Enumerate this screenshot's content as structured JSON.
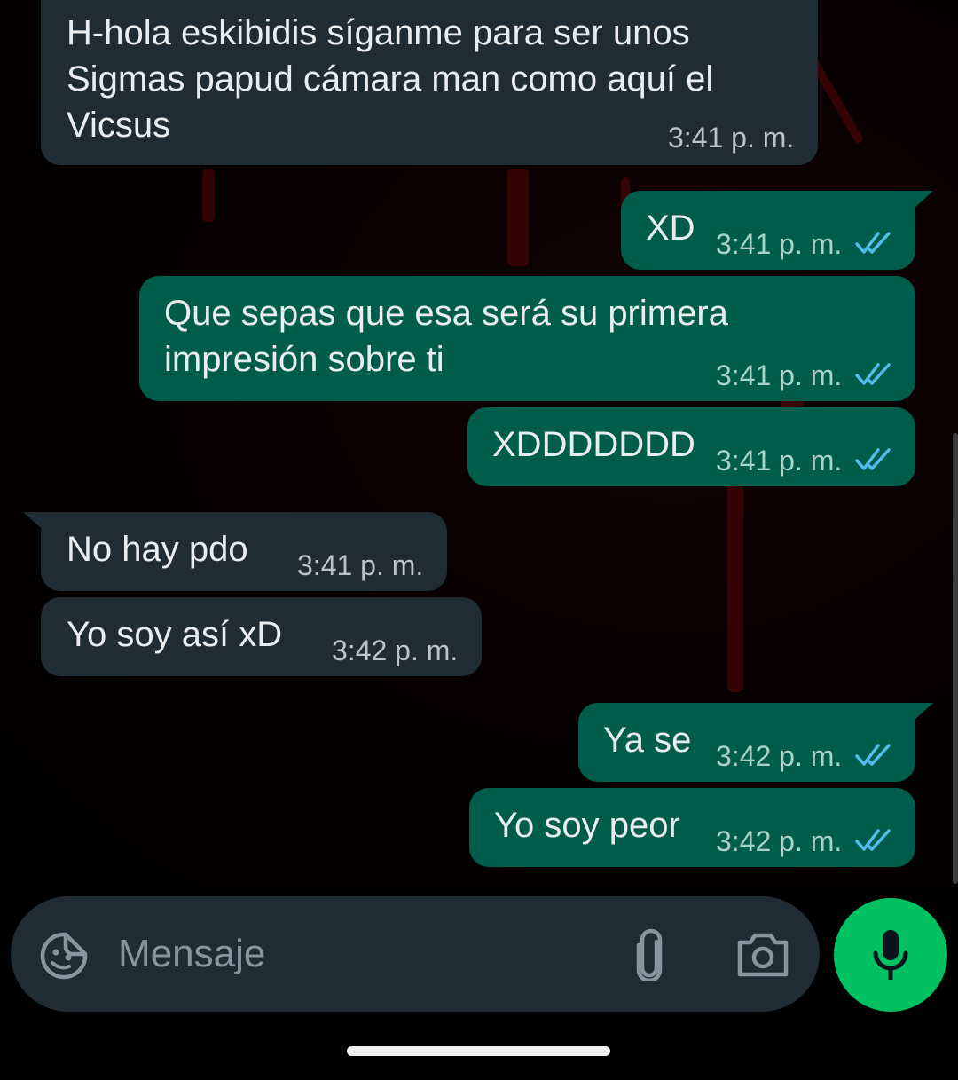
{
  "messages": [
    {
      "direction": "in",
      "text": "H-hola eskibidis síganme para ser unos\nSigmas papud cámara man como aquí el\nVicsus",
      "time": "3:41 p. m."
    },
    {
      "direction": "out",
      "text": "XD",
      "time": "3:41 p. m.",
      "status": "read"
    },
    {
      "direction": "out",
      "text": "Que sepas que esa será su primera\nimpresión sobre ti",
      "time": "3:41 p. m.",
      "status": "read"
    },
    {
      "direction": "out",
      "text": "XDDDDDDD",
      "time": "3:41 p. m.",
      "status": "read"
    },
    {
      "direction": "in",
      "text": "No hay pdo",
      "time": "3:41 p. m."
    },
    {
      "direction": "in",
      "text": "Yo soy así xD",
      "time": "3:42 p. m."
    },
    {
      "direction": "out",
      "text": "Ya se",
      "time": "3:42 p. m.",
      "status": "read"
    },
    {
      "direction": "out",
      "text": "Yo soy peor",
      "time": "3:42 p. m.",
      "status": "read"
    }
  ],
  "composer": {
    "placeholder": "Mensaje",
    "icons": [
      "sticker-icon",
      "paperclip-icon",
      "camera-icon"
    ],
    "send_icon": "microphone-icon"
  },
  "colors": {
    "incoming_bubble": "#1f2c33",
    "outgoing_bubble": "#005c4b",
    "read_ticks": "#53bdeb",
    "mic_button": "#00c062",
    "background": "#000000"
  }
}
